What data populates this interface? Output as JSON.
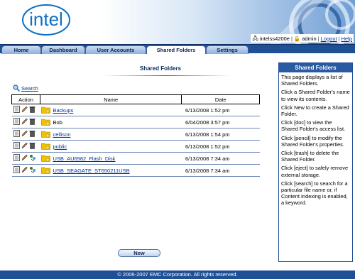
{
  "header": {
    "logo_text": "intel",
    "user_host": "intelss4200e",
    "user_name": "admin",
    "logout": "Logout",
    "help": "Help"
  },
  "tabs": [
    {
      "label": "Home"
    },
    {
      "label": "Dashboard"
    },
    {
      "label": "User Accounts"
    },
    {
      "label": "Shared Folders"
    },
    {
      "label": "Settings"
    }
  ],
  "main": {
    "title": "Shared Folders",
    "search_label": "Search",
    "columns": {
      "action": "Action",
      "name": "Name",
      "date": "Date"
    },
    "rows": [
      {
        "name": "Backups",
        "date": "6/13/2008 1:52 pm",
        "link": true,
        "external": false
      },
      {
        "name": "Bob",
        "date": "6/04/2008 3:57 pm",
        "link": false,
        "external": false
      },
      {
        "name": "cellison",
        "date": "6/13/2008 1:54 pm",
        "link": true,
        "external": false
      },
      {
        "name": "public",
        "date": "6/13/2008 1:52 pm",
        "link": true,
        "external": false
      },
      {
        "name": "USB_AU6982_Flash_Disk",
        "date": "6/13/2008 7:34 am",
        "link": true,
        "external": true
      },
      {
        "name": "USB_SEAGATE_ST650211USB",
        "date": "6/13/2008 7:34 am",
        "link": true,
        "external": true
      }
    ],
    "new_button": "New"
  },
  "help": {
    "title": "Shared Folders",
    "paragraphs": [
      "This page displays a list of Shared Folders.",
      "Click a Shared Folder's name to view its contents.",
      "Click New to create a Shared Folder.",
      "Click [doc] to view the Shared Folder's access list.",
      "Click [pencil] to modify the Shared Folder's properties.",
      "Click [trash] to delete the Shared Folder.",
      "Click [eject] to safely remove external storage.",
      "Click [search] to search for a particular file name or, if Content Indexing is enabled, a keyword."
    ]
  },
  "footer": {
    "text": "© 2006-2007 EMC Corporation. All rights reserved."
  },
  "colors": {
    "accent": "#1f4f95",
    "link": "#00319c",
    "folder": "#f2c200"
  }
}
